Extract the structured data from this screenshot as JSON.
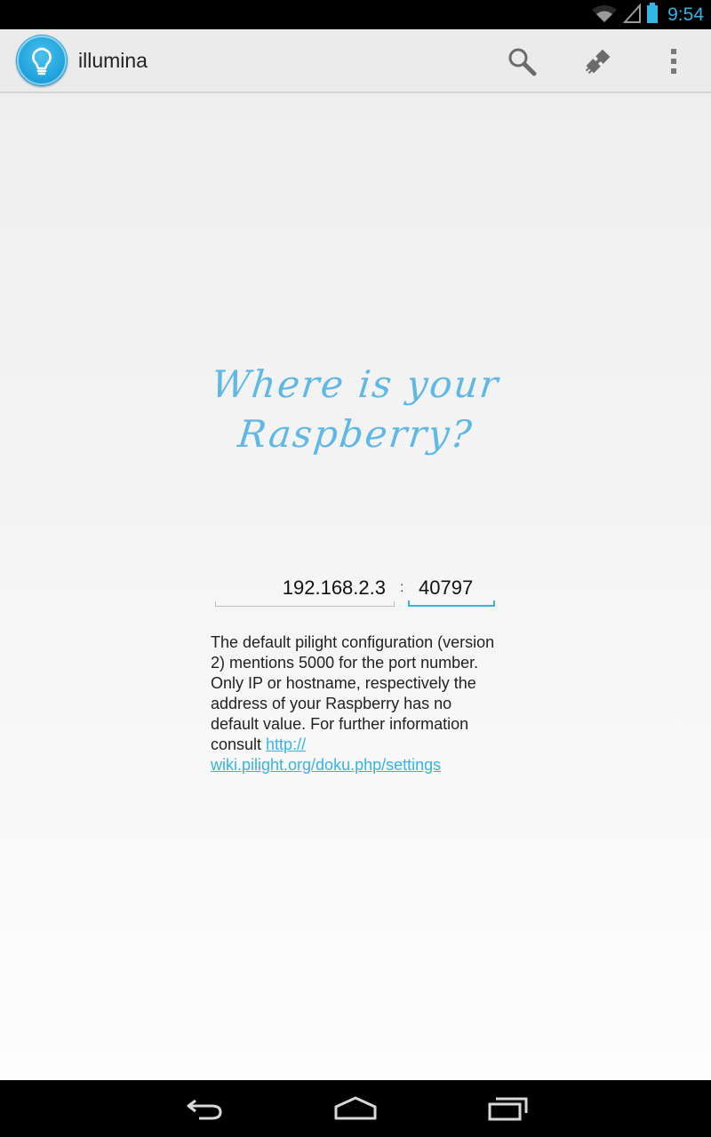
{
  "status_bar": {
    "time": "9:54",
    "icons": [
      "wifi-icon",
      "signal-icon",
      "battery-icon"
    ]
  },
  "action_bar": {
    "title": "illumina",
    "actions": [
      "search-icon",
      "connection-icon",
      "overflow-menu-icon"
    ],
    "app_icon": "lightbulb-icon"
  },
  "main": {
    "headline_line1": "Where is your",
    "headline_line2": "Raspberry?",
    "host": "192.168.2.3",
    "separator": ":",
    "port": "40797",
    "help_text": "The default pilight configuration (version 2) mentions 5000 for the port number. Only IP or hostname, respectively the address of your Raspberry has no default value. For further information consult ",
    "help_link_part1": "http://",
    "help_link_part2": "wiki.pilight.org/doku.php/settings"
  },
  "nav_bar": {
    "buttons": [
      "back-icon",
      "home-icon",
      "recent-apps-icon"
    ]
  },
  "colors": {
    "accent": "#33b5e5",
    "headline": "#5fb8e6",
    "action_bar": "#ebebeb",
    "background": "#f2f2f2"
  }
}
